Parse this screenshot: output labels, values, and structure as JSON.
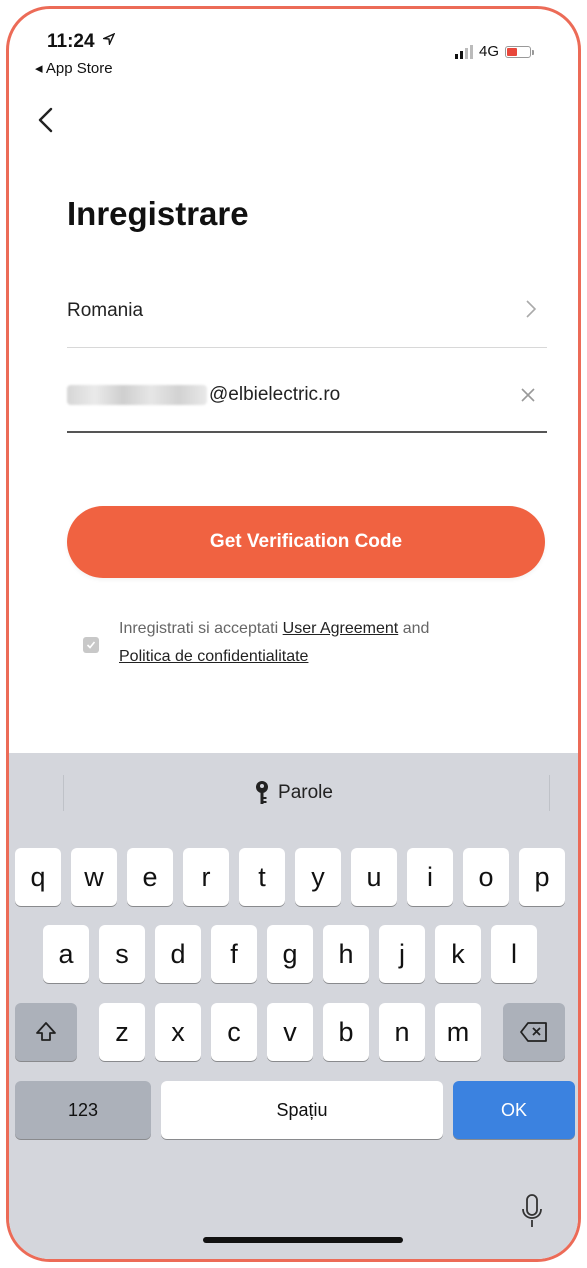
{
  "status_bar": {
    "time": "11:24",
    "back_app": "◂ App Store",
    "network": "4G"
  },
  "page": {
    "title": "Inregistrare"
  },
  "country_row": {
    "value": "Romania"
  },
  "email_row": {
    "value": "@elbielectric.ro"
  },
  "cta": {
    "label": "Get Verification Code"
  },
  "agreement": {
    "prefix": "Inregistrati si acceptati",
    "link1": "User Agreement",
    "middle": "and",
    "link2": "Politica de confidentialitate",
    "checked": true
  },
  "keyboard": {
    "suggestion_label": "Parole",
    "row1": [
      "q",
      "w",
      "e",
      "r",
      "t",
      "y",
      "u",
      "i",
      "o",
      "p"
    ],
    "row2": [
      "a",
      "s",
      "d",
      "f",
      "g",
      "h",
      "j",
      "k",
      "l"
    ],
    "row3": [
      "z",
      "x",
      "c",
      "v",
      "b",
      "n",
      "m"
    ],
    "numbers_key": "123",
    "space_key": "Spațiu",
    "return_key": "OK"
  },
  "colors": {
    "accent": "#f06241",
    "frame": "#ec6b57",
    "keyboard_bg": "#d4d6dc",
    "ok_key": "#3b82e0"
  }
}
